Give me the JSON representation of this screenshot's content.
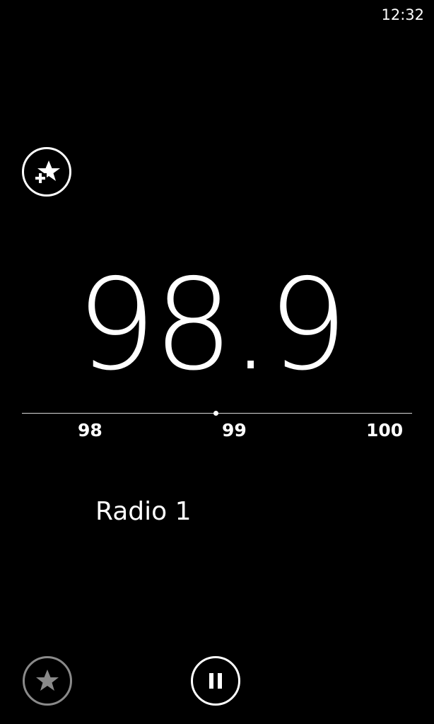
{
  "status_bar": {
    "time": "12:32"
  },
  "tuner": {
    "frequency": "98.9",
    "scale_labels": [
      "98",
      "99",
      "100"
    ]
  },
  "station": {
    "name": "Radio 1"
  },
  "icons": {
    "add_favorite": "star-plus-icon",
    "favorites": "star-icon",
    "pause": "pause-icon"
  },
  "colors": {
    "background": "#000000",
    "foreground": "#ffffff",
    "disabled": "#8a8a8a"
  }
}
